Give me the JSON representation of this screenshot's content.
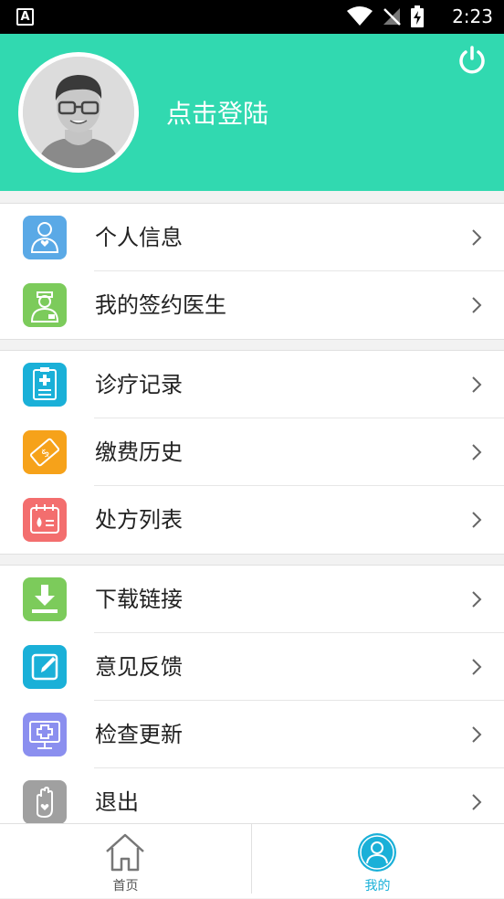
{
  "status_bar": {
    "time": "2:23",
    "notification_glyph": "A"
  },
  "header": {
    "login_label": "点击登陆",
    "background_color": "#31d9b0"
  },
  "menu_groups": [
    {
      "items": [
        {
          "label": "个人信息",
          "icon": "person-info-icon",
          "color": "#5aa9e6"
        },
        {
          "label": "我的签约医生",
          "icon": "doctor-icon",
          "color": "#7ccb5b"
        }
      ]
    },
    {
      "items": [
        {
          "label": "诊疗记录",
          "icon": "medical-record-icon",
          "color": "#1ab0d8"
        },
        {
          "label": "缴费历史",
          "icon": "payment-icon",
          "color": "#f6a21a"
        },
        {
          "label": "处方列表",
          "icon": "prescription-icon",
          "color": "#f36e6e"
        }
      ]
    },
    {
      "items": [
        {
          "label": "下载链接",
          "icon": "download-icon",
          "color": "#7ccb5b"
        },
        {
          "label": "意见反馈",
          "icon": "feedback-edit-icon",
          "color": "#1ab0d8"
        },
        {
          "label": "检查更新",
          "icon": "update-monitor-icon",
          "color": "#8b8fef"
        },
        {
          "label": "退出",
          "icon": "exit-hand-icon",
          "color": "#a0a0a0"
        }
      ]
    }
  ],
  "tabs": [
    {
      "label": "首页",
      "icon": "home-icon",
      "active": false
    },
    {
      "label": "我的",
      "icon": "profile-icon",
      "active": true
    }
  ],
  "active_tab_color": "#1ab0d8"
}
